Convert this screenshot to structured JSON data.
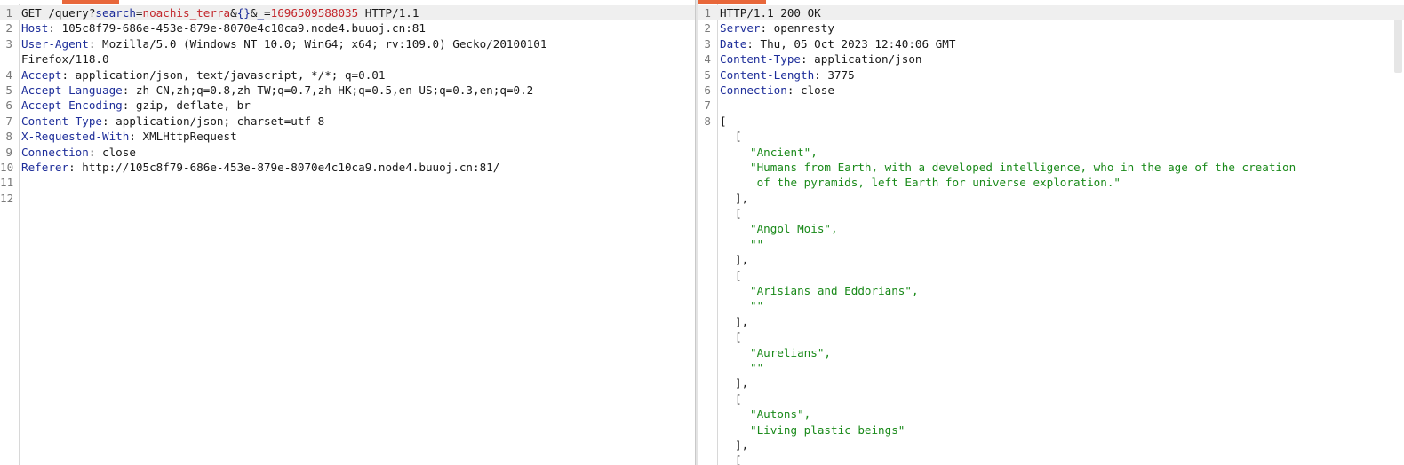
{
  "request": {
    "line1": {
      "method": "GET",
      "path": " /query?",
      "p1_name": "search",
      "eq1": "=",
      "p1_val": "noachis_terra",
      "amp1": "&",
      "braces": "{}",
      "amp2": "&",
      "p2_name": "_",
      "eq2": "=",
      "p2_val": "1696509588035",
      "version": " HTTP/1.1"
    },
    "headers": [
      {
        "num": "2",
        "key": "Host",
        "value": " 105c8f79-686e-453e-879e-8070e4c10ca9.node4.buuoj.cn:81"
      },
      {
        "num": "3",
        "key": "User-Agent",
        "value": " Mozilla/5.0 (Windows NT 10.0; Win64; x64; rv:109.0) Gecko/20100101"
      },
      {
        "num": "",
        "key": "",
        "value": "Firefox/118.0"
      },
      {
        "num": "4",
        "key": "Accept",
        "value": " application/json, text/javascript, */*; q=0.01"
      },
      {
        "num": "5",
        "key": "Accept-Language",
        "value": " zh-CN,zh;q=0.8,zh-TW;q=0.7,zh-HK;q=0.5,en-US;q=0.3,en;q=0.2"
      },
      {
        "num": "6",
        "key": "Accept-Encoding",
        "value": " gzip, deflate, br"
      },
      {
        "num": "7",
        "key": "Content-Type",
        "value": " application/json; charset=utf-8"
      },
      {
        "num": "8",
        "key": "X-Requested-With",
        "value": " XMLHttpRequest"
      },
      {
        "num": "9",
        "key": "Connection",
        "value": " close"
      },
      {
        "num": "10",
        "key": "Referer",
        "value": " http://105c8f79-686e-453e-879e-8070e4c10ca9.node4.buuoj.cn:81/"
      },
      {
        "num": "11",
        "key": "",
        "value": ""
      },
      {
        "num": "12",
        "key": "",
        "value": ""
      }
    ]
  },
  "response": {
    "status_line": "HTTP/1.1 200 OK",
    "headers": [
      {
        "num": "2",
        "key": "Server",
        "value": " openresty"
      },
      {
        "num": "3",
        "key": "Date",
        "value": " Thu, 05 Oct 2023 12:40:06 GMT"
      },
      {
        "num": "4",
        "key": "Content-Type",
        "value": " application/json"
      },
      {
        "num": "5",
        "key": "Content-Length",
        "value": " 3775"
      },
      {
        "num": "6",
        "key": "Connection",
        "value": " close"
      },
      {
        "num": "7",
        "key": "",
        "value": ""
      }
    ],
    "body_open": "[",
    "body_line_num": "8",
    "entries": [
      {
        "name": "\"Ancient\",",
        "desc": "\"Humans from Earth, with a developed intelligence, who in the age of the creation",
        "desc2": " of the pyramids, left Earth for universe exploration.\""
      },
      {
        "name": "\"Angol Mois\",",
        "desc": "\"\"",
        "desc2": ""
      },
      {
        "name": "\"Arisians and Eddorians\",",
        "desc": "\"\"",
        "desc2": ""
      },
      {
        "name": "\"Aurelians\",",
        "desc": "\"\"",
        "desc2": ""
      },
      {
        "name": "\"Autons\",",
        "desc": "\"Living plastic beings\"",
        "desc2": ""
      }
    ],
    "open_bracket": "[",
    "close_bracket": "],"
  }
}
